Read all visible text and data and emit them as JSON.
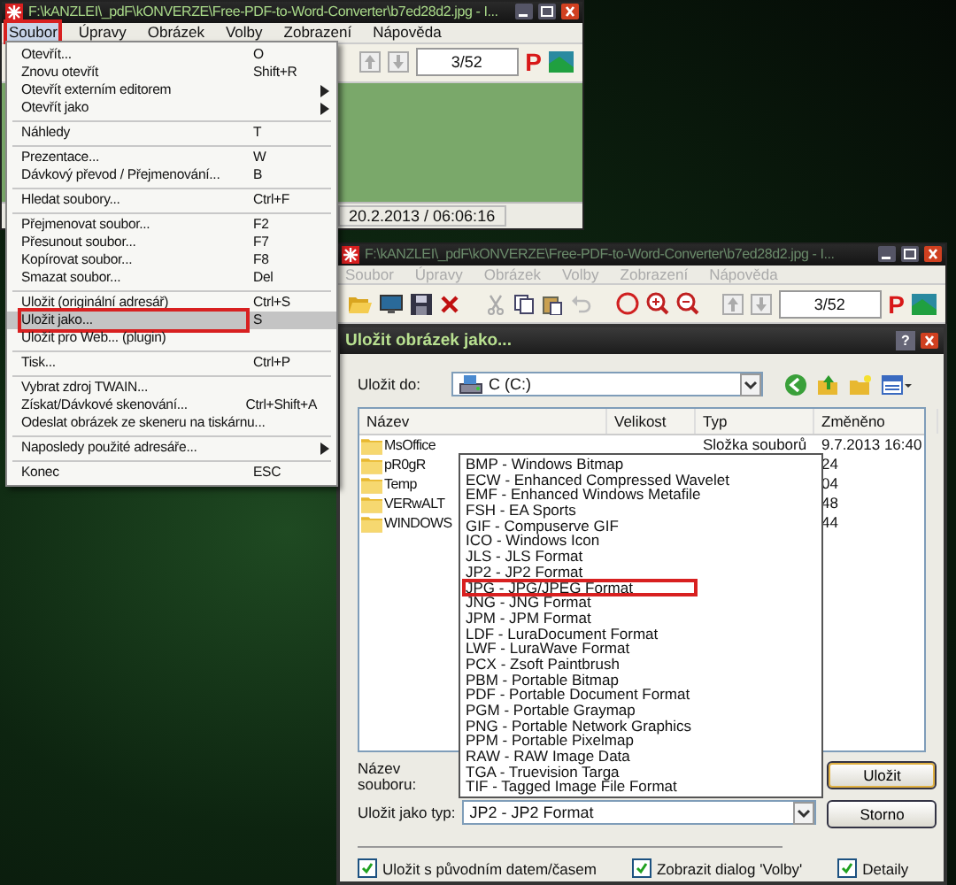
{
  "main_window": {
    "title": "F:\\kANZLEI\\_pdF\\kONVERZE\\Free-PDF-to-Word-Converter\\b7ed28d2.jpg - I...",
    "menu": [
      {
        "label": "Soubor",
        "selected": true,
        "outlined": true
      },
      {
        "label": "Úpravy",
        "selected": false,
        "outlined": false
      },
      {
        "label": "Obrázek",
        "selected": false,
        "outlined": false
      },
      {
        "label": "Volby",
        "selected": false,
        "outlined": false
      },
      {
        "label": "Zobrazení",
        "selected": false,
        "outlined": false
      },
      {
        "label": "Nápověda",
        "selected": false,
        "outlined": false
      }
    ],
    "page_counter": "3/52",
    "logo_letter": "P",
    "status_date": "20.2.2013 / 06:06:16"
  },
  "file_menu": {
    "items": [
      {
        "kind": "item",
        "label": "Otevřít...",
        "shortcut": "O",
        "submenu": false,
        "selected": false,
        "outlined": false
      },
      {
        "kind": "item",
        "label": "Znovu otevřít",
        "shortcut": "Shift+R",
        "submenu": false,
        "selected": false,
        "outlined": false
      },
      {
        "kind": "item",
        "label": "Otevřít externím editorem",
        "submenu": true,
        "selected": false,
        "outlined": false
      },
      {
        "kind": "item",
        "label": "Otevřít jako",
        "submenu": true,
        "selected": false,
        "outlined": false
      },
      {
        "kind": "separator"
      },
      {
        "kind": "item",
        "label": "Náhledy",
        "shortcut": "T",
        "submenu": false,
        "selected": false,
        "outlined": false
      },
      {
        "kind": "separator"
      },
      {
        "kind": "item",
        "label": "Prezentace...",
        "shortcut": "W",
        "submenu": false,
        "selected": false,
        "outlined": false
      },
      {
        "kind": "item",
        "label": "Dávkový převod / Přejmenování...",
        "shortcut": "B",
        "submenu": false,
        "selected": false,
        "outlined": false
      },
      {
        "kind": "separator"
      },
      {
        "kind": "item",
        "label": "Hledat soubory...",
        "shortcut": "Ctrl+F",
        "submenu": false,
        "selected": false,
        "outlined": false
      },
      {
        "kind": "separator"
      },
      {
        "kind": "item",
        "label": "Přejmenovat soubor...",
        "shortcut": "F2",
        "submenu": false,
        "selected": false,
        "outlined": false
      },
      {
        "kind": "item",
        "label": "Přesunout soubor...",
        "shortcut": "F7",
        "submenu": false,
        "selected": false,
        "outlined": false
      },
      {
        "kind": "item",
        "label": "Kopírovat soubor...",
        "shortcut": "F8",
        "submenu": false,
        "selected": false,
        "outlined": false
      },
      {
        "kind": "item",
        "label": "Smazat soubor...",
        "shortcut": "Del",
        "submenu": false,
        "selected": false,
        "outlined": false
      },
      {
        "kind": "separator"
      },
      {
        "kind": "item",
        "label": "Uložit (originální adresář)",
        "shortcut": "Ctrl+S",
        "submenu": false,
        "selected": false,
        "outlined": false
      },
      {
        "kind": "item",
        "label": "Uložit jako...",
        "shortcut": "S",
        "submenu": false,
        "selected": true,
        "outlined": true
      },
      {
        "kind": "item",
        "label": "Uložit pro Web... (plugin)",
        "submenu": false,
        "selected": false,
        "outlined": false
      },
      {
        "kind": "separator"
      },
      {
        "kind": "item",
        "label": "Tisk...",
        "shortcut": "Ctrl+P",
        "submenu": false,
        "selected": false,
        "outlined": false
      },
      {
        "kind": "separator"
      },
      {
        "kind": "item",
        "label": "Vybrat zdroj TWAIN...",
        "submenu": false,
        "selected": false,
        "outlined": false
      },
      {
        "kind": "item",
        "label": "Získat/Dávkové skenování...",
        "shortcut": "Ctrl+Shift+A",
        "submenu": false,
        "selected": false,
        "outlined": false
      },
      {
        "kind": "item",
        "label": "Odeslat obrázek ze skeneru na tiskárnu...",
        "submenu": false,
        "selected": false,
        "outlined": false
      },
      {
        "kind": "separator"
      },
      {
        "kind": "item",
        "label": "Naposledy použité adresáře...",
        "submenu": true,
        "selected": false,
        "outlined": false
      },
      {
        "kind": "separator"
      },
      {
        "kind": "item",
        "label": "Konec",
        "shortcut": "ESC",
        "submenu": false,
        "selected": false,
        "outlined": false
      }
    ]
  },
  "second_window": {
    "title": "F:\\kANZLEI\\_pdF\\kONVERZE\\Free-PDF-to-Word-Converter\\b7ed28d2.jpg - I...",
    "menu": [
      {
        "label": "Soubor",
        "disabled": true
      },
      {
        "label": "Úpravy",
        "disabled": true
      },
      {
        "label": "Obrázek",
        "disabled": true
      },
      {
        "label": "Volby",
        "disabled": true
      },
      {
        "label": "Zobrazení",
        "disabled": true
      },
      {
        "label": "Nápověda",
        "disabled": true
      }
    ],
    "page_counter": "3/52",
    "logo_letter": "P"
  },
  "save_dialog": {
    "title": "Uložit obrázek jako...",
    "help_button": "?",
    "save_in_label": "Uložit do:",
    "save_in_value": "C (C:)",
    "columns": [
      "Název",
      "Velikost",
      "Typ",
      "Změněno"
    ],
    "rows": [
      {
        "name": "MsOffice",
        "type": "Složka souborů",
        "changed": "9.7.2013 16:40"
      },
      {
        "name": "pR0gR",
        "changed": "24"
      },
      {
        "name": "Temp",
        "changed": "04"
      },
      {
        "name": "VERwALT",
        "changed": "48"
      },
      {
        "name": "WINDOWS",
        "changed": "44"
      }
    ],
    "file_name_label": "Název souboru:",
    "file_type_label": "Uložit jako typ:",
    "file_type_value": "JP2 - JP2 Format",
    "file_type_options": [
      {
        "label": "BMP - Windows Bitmap",
        "outlined": false
      },
      {
        "label": "ECW - Enhanced Compressed Wavelet",
        "outlined": false
      },
      {
        "label": "EMF - Enhanced Windows Metafile",
        "outlined": false
      },
      {
        "label": "FSH - EA Sports",
        "outlined": false
      },
      {
        "label": "GIF - Compuserve GIF",
        "outlined": false
      },
      {
        "label": "ICO - Windows Icon",
        "outlined": false
      },
      {
        "label": "JLS - JLS Format",
        "outlined": false
      },
      {
        "label": "JP2 - JP2 Format",
        "outlined": false
      },
      {
        "label": "JPG - JPG/JPEG Format",
        "outlined": true
      },
      {
        "label": "JNG - JNG Format",
        "outlined": false
      },
      {
        "label": "JPM - JPM Format",
        "outlined": false
      },
      {
        "label": "LDF - LuraDocument Format",
        "outlined": false
      },
      {
        "label": "LWF - LuraWave Format",
        "outlined": false
      },
      {
        "label": "PCX - Zsoft Paintbrush",
        "outlined": false
      },
      {
        "label": "PBM - Portable Bitmap",
        "outlined": false
      },
      {
        "label": "PDF - Portable Document Format",
        "outlined": false
      },
      {
        "label": "PGM - Portable Graymap",
        "outlined": false
      },
      {
        "label": "PNG - Portable Network Graphics",
        "outlined": false
      },
      {
        "label": "PPM - Portable Pixelmap",
        "outlined": false
      },
      {
        "label": "RAW - RAW Image Data",
        "outlined": false
      },
      {
        "label": "TGA - Truevision Targa",
        "outlined": false
      },
      {
        "label": "TIF - Tagged Image File Format",
        "outlined": false
      }
    ],
    "buttons": [
      {
        "label": "Uložit",
        "kind": "default"
      },
      {
        "label": "Storno",
        "kind": "normal"
      }
    ],
    "options": [
      {
        "label": "Uložit s původním datem/časem",
        "checked": true
      },
      {
        "label": "Zobrazit dialog 'Volby'",
        "checked": true
      },
      {
        "label": "Detaily",
        "checked": true
      }
    ]
  }
}
